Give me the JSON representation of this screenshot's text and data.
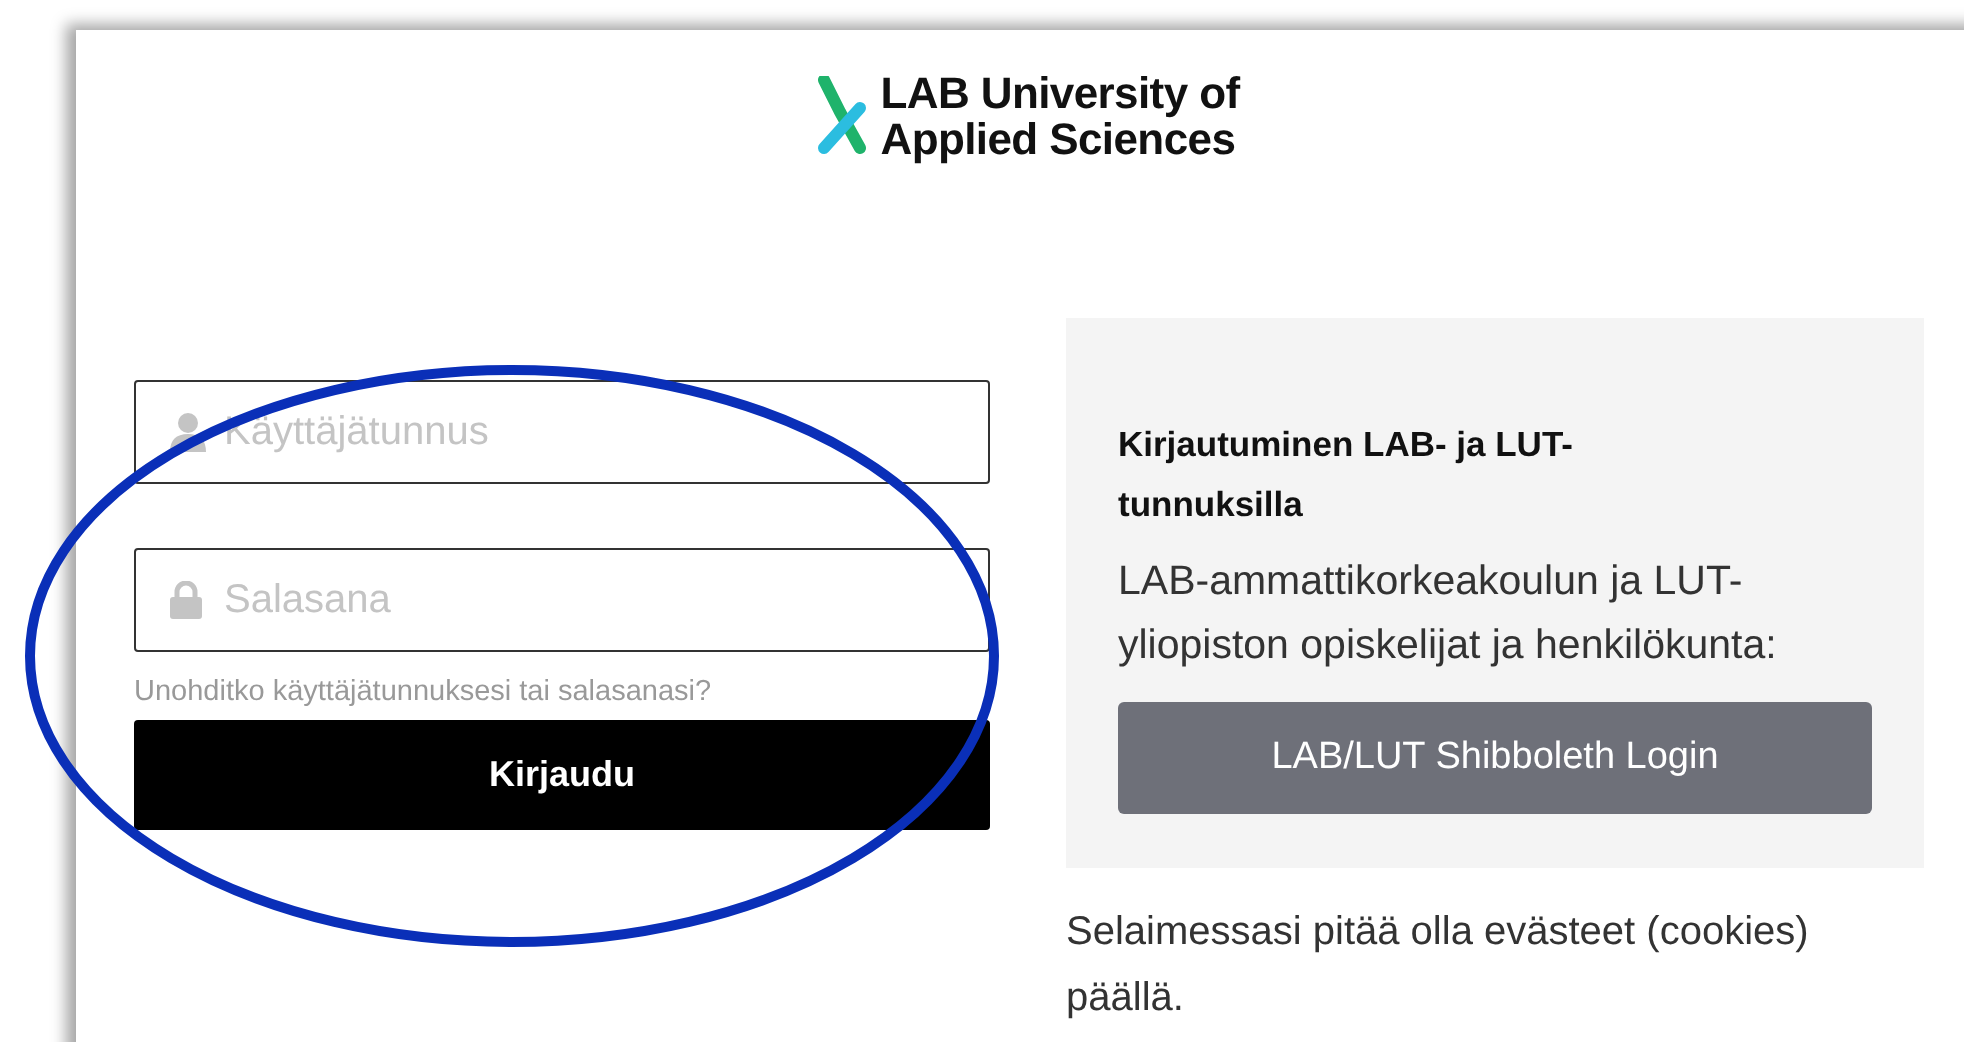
{
  "logo": {
    "line_1": "LAB University of",
    "line_2": "Applied Sciences"
  },
  "login_form": {
    "username": {
      "placeholder": "Käyttäjätunnus"
    },
    "password": {
      "placeholder": "Salasana"
    },
    "forgot_link": "Unohditko käyttäjätunnuksesi tai salasanasi?",
    "submit": "Kirjaudu"
  },
  "sso_panel": {
    "heading": "Kirjautuminen LAB- ja LUT-tunnuksilla",
    "text": "LAB-ammattikorkeakoulun ja LUT-yliopiston opiskelijat ja henkilökunta:",
    "button": "LAB/LUT Shibboleth Login"
  },
  "cookie_notice": "Selaimessasi pitää olla evästeet (cookies) päällä."
}
